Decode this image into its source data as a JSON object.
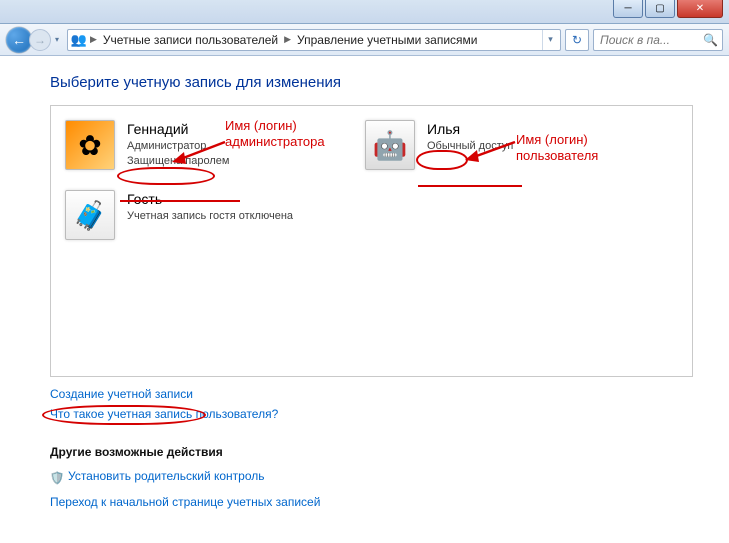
{
  "window": {
    "minimize_label": "─",
    "maximize_label": "▢",
    "close_label": "✕"
  },
  "nav": {
    "back_glyph": "←",
    "fwd_glyph": "→",
    "history_glyph": "▾",
    "refresh_glyph": "↻",
    "breadcrumb": {
      "icon": "👥",
      "seg1": "Учетные записи пользователей",
      "seg2": "Управление учетными записями"
    },
    "search_placeholder": "Поиск в па...",
    "search_glyph": "🔍"
  },
  "page": {
    "title": "Выберите учетную запись для изменения"
  },
  "accounts": [
    {
      "name_key": "accounts.0.name",
      "name": "Геннадий",
      "role": "Администратор",
      "status": "Защищена паролем",
      "pic_class": "flower",
      "pic_glyph": "✿"
    },
    {
      "name_key": "accounts.1.name",
      "name": "Илья",
      "role": "Обычный доступ",
      "status": "",
      "pic_class": "robot",
      "pic_glyph": "🤖"
    },
    {
      "name_key": "accounts.2.name",
      "name": "Гость",
      "role": "Учетная запись гостя отключена",
      "status": "",
      "pic_class": "guest",
      "pic_glyph": "🧳"
    }
  ],
  "links": {
    "create": "Создание учетной записи",
    "whatis": "Что такое учетная запись пользователя?"
  },
  "other": {
    "header": "Другие возможные действия",
    "parental": "Установить родительский контроль",
    "goto": "Переход к начальной странице учетных записей"
  },
  "annotations": {
    "admin_label": "Имя (логин)\nадминистратора",
    "user_label": "Имя (логин)\nпользователя"
  }
}
